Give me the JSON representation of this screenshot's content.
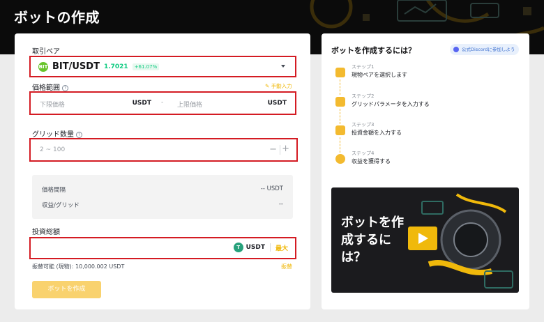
{
  "header": {
    "title": "ボットの作成"
  },
  "form": {
    "pair_label": "取引ペア",
    "pair": {
      "coin_icon": "BIT",
      "name": "BIT/USDT",
      "price": "1.7021",
      "change": "+61.07%"
    },
    "price_range_label": "価格範囲",
    "manual_input": "手動入力",
    "lower_placeholder": "下限価格",
    "upper_placeholder": "上限価格",
    "lower_unit": "USDT",
    "upper_unit": "USDT",
    "range_sep": "-",
    "grid_label": "グリッド数量",
    "grid_placeholder": "2 ~ 100",
    "grid_minus": "−",
    "grid_plus": "+",
    "info": {
      "price_interval_label": "価格間隔",
      "price_interval_value": "-- USDT",
      "profit_label": "収益/グリッド",
      "profit_value": "--"
    },
    "investment_label": "投資総額",
    "investment_unit": "USDT",
    "investment_coin_icon": "T",
    "max_label": "最大",
    "available_text": "振替可能 (現物): 10,000.002 USDT",
    "transfer_link": "振替",
    "create_button": "ボットを作成"
  },
  "guide": {
    "title": "ボットを作成するには？",
    "discord": "公式Discordに参加しよう",
    "steps": [
      {
        "small": "ステップ1",
        "main": "現物ペアを選択します"
      },
      {
        "small": "ステップ2",
        "main": "グリッドパラメータを入力する"
      },
      {
        "small": "ステップ3",
        "main": "投資金額を入力する"
      },
      {
        "small": "ステップ4",
        "main": "収益を獲得する"
      }
    ],
    "video_title": "ボットを作成するには？"
  },
  "colors": {
    "accent": "#f0b90b",
    "highlight": "#d41b23",
    "positive": "#0ecb81"
  }
}
